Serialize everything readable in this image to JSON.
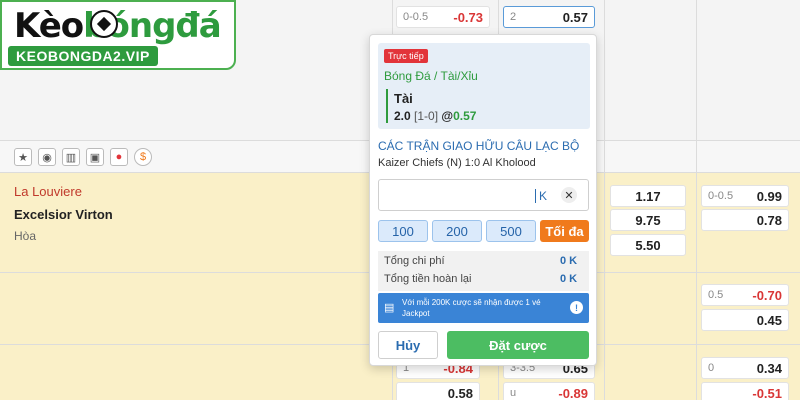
{
  "logo": {
    "title_pre": "Kèo",
    "title_post": "bóngđá",
    "subtitle": "KEOBONGDA2.VIP"
  },
  "colors": {
    "accent_green": "#2e9b3e",
    "band_yellow": "#faf0c8",
    "negative_red": "#d93636",
    "slip_blue": "#2b6cb0",
    "max_orange": "#f07a1c",
    "place_bet_green": "#4cbd62"
  },
  "top_cells": {
    "a": {
      "handicap": "0-0.5",
      "odds": "-0.73"
    },
    "b": {
      "handicap": "2",
      "odds": "0.57"
    }
  },
  "tools": [
    "star-icon",
    "eye-icon",
    "stats-icon",
    "field-icon",
    "fire-icon",
    "coin-icon"
  ],
  "match": {
    "home": "La Louviere",
    "away": "Excelsior Virton",
    "draw": "Hòa"
  },
  "odds_1x2": [
    "1.17",
    "9.75",
    "5.50"
  ],
  "right_col": [
    {
      "handicap": "0-0.5",
      "odds": "0.99"
    },
    {
      "handicap": "",
      "odds": "0.78"
    },
    {
      "handicap": "0.5",
      "odds": "-0.70"
    },
    {
      "handicap": "",
      "odds": "0.45"
    },
    {
      "handicap": "0",
      "odds": "0.34"
    },
    {
      "handicap": "",
      "odds": "-0.51"
    }
  ],
  "bottom_cells": [
    {
      "handicap": "1",
      "odds": "-0.84"
    },
    {
      "handicap": "3-3.5",
      "odds": "0.65"
    },
    {
      "handicap": "",
      "odds": "0.58"
    },
    {
      "handicap": "u",
      "odds": "-0.89"
    }
  ],
  "slip": {
    "live_badge": "Trực tiếp",
    "market": "Bóng Đá / Tài/Xỉu",
    "selection": "Tài",
    "line": "2.0",
    "score": "[1-0]",
    "at": "@",
    "price": "0.57",
    "league": "CÁC TRẬN GIAO HỮU CÂU LẠC BỘ",
    "fixture": "Kaizer Chiefs (N) 1:0 Al Kholood",
    "stake_suffix": "K",
    "amounts": [
      "100",
      "200",
      "500"
    ],
    "max_label": "Tối đa",
    "total_cost_label": "Tổng chi phí",
    "total_cost_value": "0 K",
    "total_return_label": "Tổng tiền hoàn lại",
    "total_return_value": "0 K",
    "promo": "Với mỗi 200K cược sẽ nhận được 1 vé Jackpot",
    "cancel": "Hủy",
    "place": "Đặt cược"
  }
}
